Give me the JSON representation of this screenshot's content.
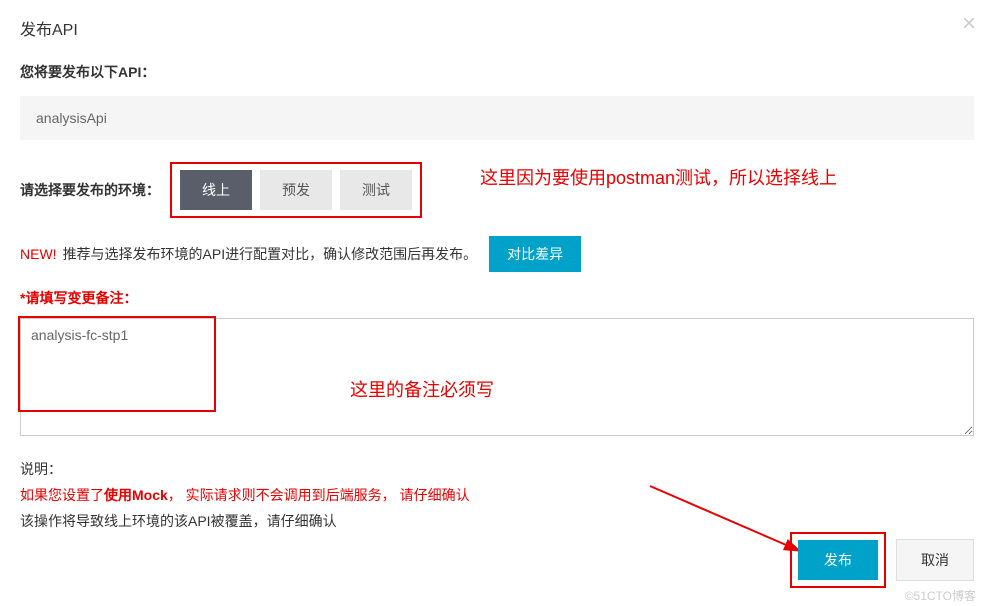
{
  "modal": {
    "title": "发布API",
    "close_label": "×"
  },
  "publish_section": {
    "label": "您将要发布以下API：",
    "api_name": "analysisApi"
  },
  "env_section": {
    "label": "请选择要发布的环境：",
    "options": {
      "online": "线上",
      "pre": "预发",
      "test": "测试"
    }
  },
  "compare_section": {
    "new_badge": "NEW!",
    "text": "推荐与选择发布环境的API进行配置对比，确认修改范围后再发布。",
    "button": "对比差异"
  },
  "remark_section": {
    "label": "请填写变更备注：",
    "value": "analysis-fc-stp1"
  },
  "description_section": {
    "label": "说明：",
    "mock_warning_prefix": "如果您设置了",
    "mock_warning_bold": "使用Mock",
    "mock_warning_suffix": "， 实际请求则不会调用到后端服务， 请仔细确认",
    "overwrite_warning": "该操作将导致线上环境的该API被覆盖，请仔细确认"
  },
  "footer": {
    "publish": "发布",
    "cancel": "取消"
  },
  "annotations": {
    "env_note": "这里因为要使用postman测试，所以选择线上",
    "remark_note": "这里的备注必须写"
  },
  "watermark": "©51CTO博客"
}
